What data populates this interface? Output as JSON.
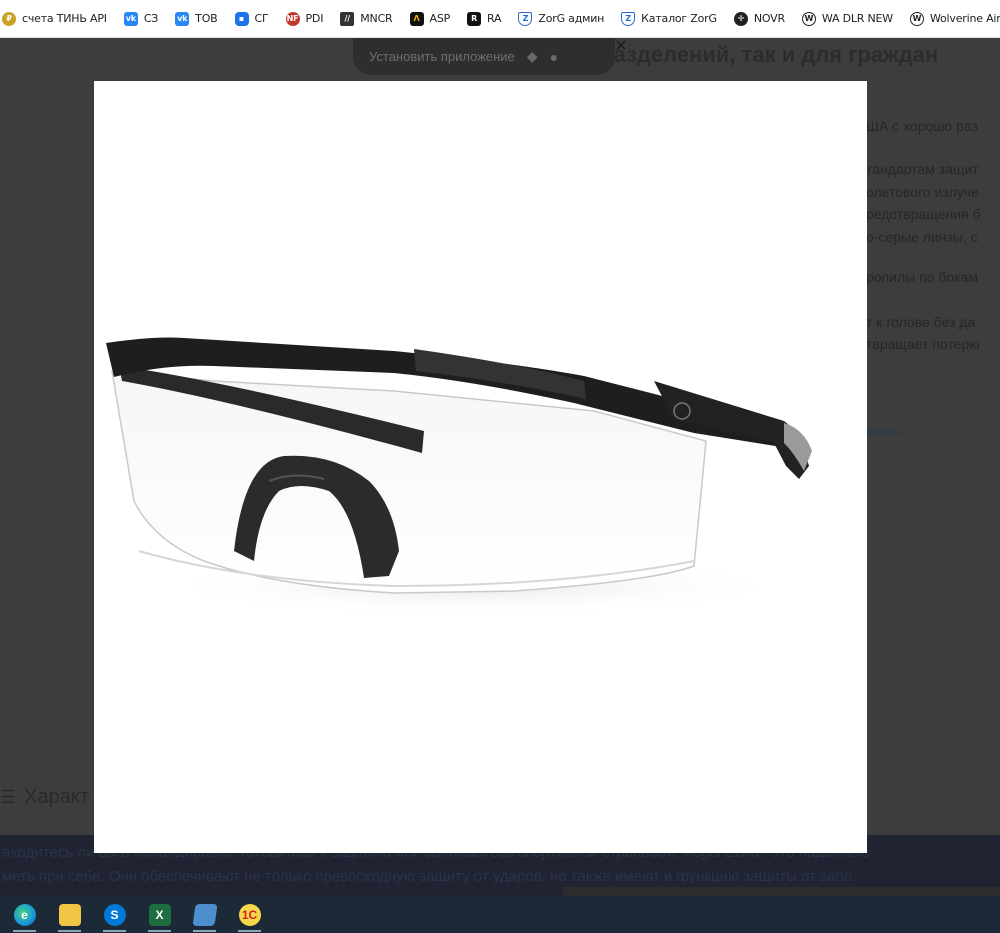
{
  "bookmarks": [
    {
      "icon": "coin-icon",
      "label": "счета ТИНЬ API"
    },
    {
      "icon": "vk-icon",
      "label": "СЗ"
    },
    {
      "icon": "vk-icon",
      "label": "ТОВ"
    },
    {
      "icon": "chat-icon",
      "label": "СГ"
    },
    {
      "icon": "pdi-icon",
      "label": "PDI"
    },
    {
      "icon": "mncr-icon",
      "label": "MNCR"
    },
    {
      "icon": "asp-icon",
      "label": "ASP"
    },
    {
      "icon": "ra-icon",
      "label": "RA"
    },
    {
      "icon": "zorg-shield-icon",
      "label": "ZorG админ"
    },
    {
      "icon": "zorg-shield-icon",
      "label": "Каталог ZorG"
    },
    {
      "icon": "novr-icon",
      "label": "NOVR"
    },
    {
      "icon": "wa-icon",
      "label": "WA DLR NEW"
    },
    {
      "icon": "wa-icon",
      "label": "Wolverine Airsoft"
    }
  ],
  "page": {
    "install_label": "Установить приложение",
    "heading": "разделений, так и для граждан",
    "right_lines": [
      "ША с хорошо раз",
      "тандартам защит",
      "олетового излуче",
      "редотвращения б",
      "о-серые линзы, с",
      "ропилы по бокам",
      "т к голове без да",
      "твращает потерю"
    ],
    "right_link": "менить",
    "characteristics_label": "Характ",
    "bottom_line_1": "аходитесь ли вы в командировке, готовитесь к заданию или занимаетесь спортивной стрельбой, Aegis Echo - это надёжные",
    "bottom_line_2": "меть при себе. Они обеспечивают не только превосходную защиту от ударов, но также имеют и функцию защиты от запо"
  },
  "lightbox": {
    "image_alt": "Тактические защитные очки с прозрачными линзами",
    "close_symbol": "✕"
  },
  "taskbar": [
    {
      "name": "edge-icon",
      "glyph": "e"
    },
    {
      "name": "file-explorer-icon",
      "glyph": ""
    },
    {
      "name": "skype-icon",
      "glyph": "S"
    },
    {
      "name": "excel-icon",
      "glyph": "X"
    },
    {
      "name": "notes-icon",
      "glyph": ""
    },
    {
      "name": "1c-icon",
      "glyph": "1С"
    }
  ],
  "colors": {
    "overlay_bg": "#3d3d3d",
    "taskbar_bg": "#1c2a38",
    "bookmarks_bg": "#ffffff"
  }
}
